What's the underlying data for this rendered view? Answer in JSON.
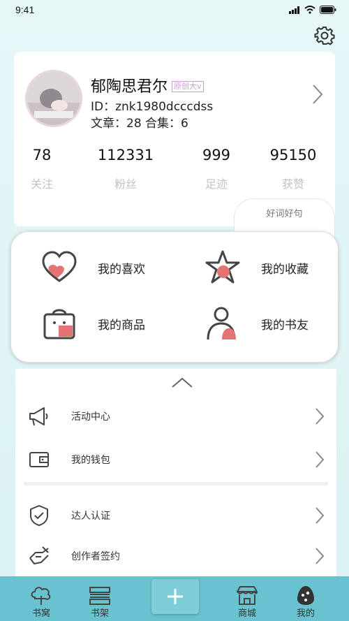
{
  "status_bar": {
    "time": "9:41"
  },
  "profile": {
    "name": "郁陶思君尔",
    "badge": "原创大v",
    "id_text": "ID：znk1980dcccdss",
    "works_text": "文章：28  合集：6"
  },
  "stats": [
    {
      "value": "78",
      "label": "关注"
    },
    {
      "value": "112331",
      "label": "粉丝"
    },
    {
      "value": "999",
      "label": "足迹"
    },
    {
      "value": "95150",
      "label": "获赞"
    }
  ],
  "good_words": {
    "label": "好词好句"
  },
  "quick_actions": [
    {
      "label": "我的喜欢",
      "icon": "heart-icon"
    },
    {
      "label": "我的收藏",
      "icon": "star-icon"
    },
    {
      "label": "我的商品",
      "icon": "bag-icon"
    },
    {
      "label": "我的书友",
      "icon": "person-icon"
    }
  ],
  "menu": [
    {
      "label": "活动中心",
      "icon": "megaphone-icon"
    },
    {
      "label": "我的钱包",
      "icon": "wallet-icon"
    },
    {
      "label": "达人认证",
      "icon": "shield-check-icon"
    },
    {
      "label": "创作者签约",
      "icon": "sign-hand-icon"
    }
  ],
  "tabbar": [
    {
      "label": "书窝",
      "icon": "tree-icon"
    },
    {
      "label": "书架",
      "icon": "shelf-icon"
    },
    {
      "label": "商城",
      "icon": "store-icon"
    },
    {
      "label": "我的",
      "icon": "profile-egg-icon"
    }
  ],
  "colors": {
    "accent": "#e57373",
    "tabbar": "#69c2d0",
    "background": "#dbf1f3"
  }
}
